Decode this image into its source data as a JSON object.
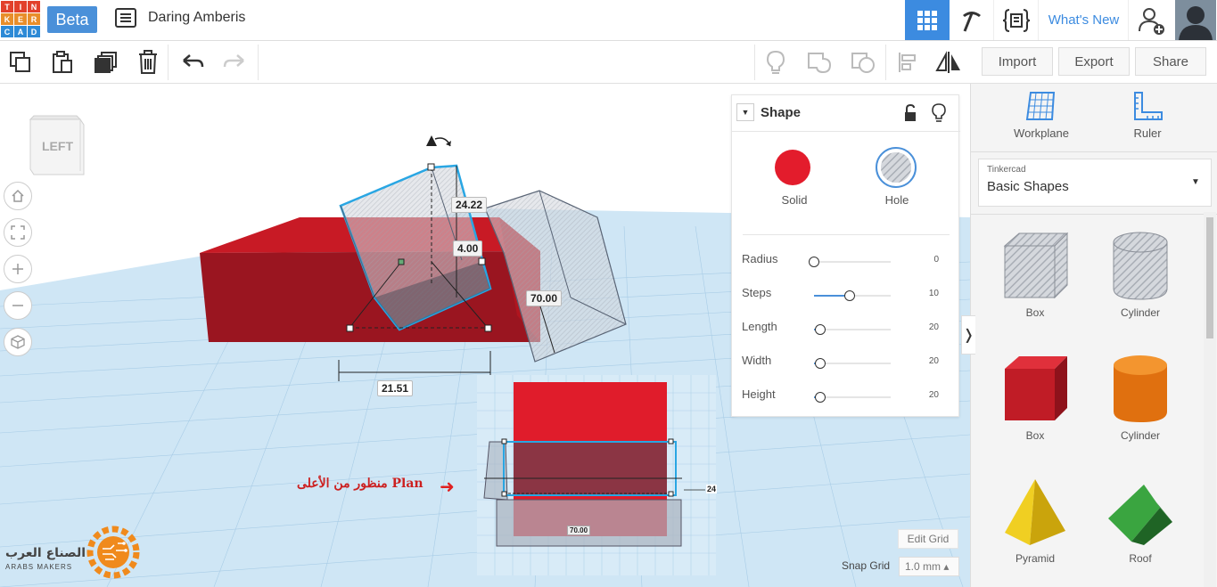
{
  "header": {
    "logo_letters": [
      "T",
      "I",
      "N",
      "K",
      "E",
      "R",
      "C",
      "A",
      "D"
    ],
    "logo_colors": [
      "#e2402b",
      "#e2402b",
      "#e2402b",
      "#e88e2a",
      "#e88e2a",
      "#e88e2a",
      "#2d8ad6",
      "#2d8ad6",
      "#2d8ad6"
    ],
    "beta_label": "Beta",
    "design_title": "Daring Amberis",
    "whats_new_label": "What's New",
    "accent": "#3c8be0"
  },
  "toolbar": {
    "import_label": "Import",
    "export_label": "Export",
    "share_label": "Share"
  },
  "view_cube": {
    "face_label": "LEFT"
  },
  "dimensions": {
    "height_top": "24.22",
    "elevation": "4.00",
    "length_side": "70.00",
    "width_bottom": "21.51"
  },
  "annotation": {
    "plan_note": "منظور من الأعلى Plan",
    "inset_dim_side": "24",
    "inset_dim_bottom": "70.00"
  },
  "brand": {
    "arabic": "الصناع العرب",
    "english": "ARABS MAKERS"
  },
  "grid_controls": {
    "edit_grid_label": "Edit Grid",
    "snap_grid_label": "Snap Grid",
    "snap_grid_value": "1.0 mm ▴"
  },
  "inspector": {
    "title": "Shape",
    "solid_label": "Solid",
    "hole_label": "Hole",
    "solid_color": "#e31c2c",
    "params": [
      {
        "name": "Radius",
        "value": "0",
        "fraction": 0.0
      },
      {
        "name": "Steps",
        "value": "10",
        "fraction": 0.47
      },
      {
        "name": "Length",
        "value": "20",
        "fraction": 0.08
      },
      {
        "name": "Width",
        "value": "20",
        "fraction": 0.08
      },
      {
        "name": "Height",
        "value": "20",
        "fraction": 0.08
      }
    ]
  },
  "right_panel": {
    "workplane_label": "Workplane",
    "ruler_label": "Ruler",
    "library_kicker": "Tinkercad",
    "library_name": "Basic Shapes",
    "shapes": [
      {
        "name": "Box",
        "kind": "box-hole-icon"
      },
      {
        "name": "Cylinder",
        "kind": "cylinder-hole-icon"
      },
      {
        "name": "Box",
        "kind": "box-red-icon"
      },
      {
        "name": "Cylinder",
        "kind": "cylinder-orange-icon"
      },
      {
        "name": "Pyramid",
        "kind": "pyramid-icon"
      },
      {
        "name": "Roof",
        "kind": "roof-icon"
      }
    ]
  }
}
